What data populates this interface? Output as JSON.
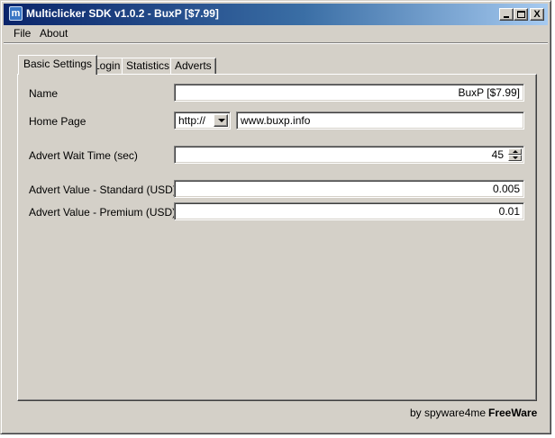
{
  "window": {
    "title": "Multiclicker SDK v1.0.2 - BuxP [$7.99]",
    "icon_letter": "m",
    "controls": [
      "minimize-icon",
      "maximize-icon",
      "close-icon"
    ],
    "close_glyph": "X"
  },
  "menu": {
    "items": [
      "File",
      "About"
    ]
  },
  "tabs": [
    {
      "label": "Basic Settings",
      "active": true
    },
    {
      "label": "Login",
      "active": false
    },
    {
      "label": "Statistics",
      "active": false
    },
    {
      "label": "Adverts",
      "active": false
    }
  ],
  "form": {
    "name": {
      "label": "Name",
      "value": "BuxP [$7.99]"
    },
    "home_page": {
      "label": "Home Page",
      "protocol": "http://",
      "url": "www.buxp.info"
    },
    "wait_time": {
      "label": "Advert Wait Time (sec)",
      "value": "45"
    },
    "value_standard": {
      "label": "Advert Value - Standard (USD)",
      "value": "0.005"
    },
    "value_premium": {
      "label": "Advert Value - Premium (USD)",
      "value": "0.01"
    }
  },
  "footer": {
    "credit": "by spyware4me",
    "license": "FreeWare"
  }
}
